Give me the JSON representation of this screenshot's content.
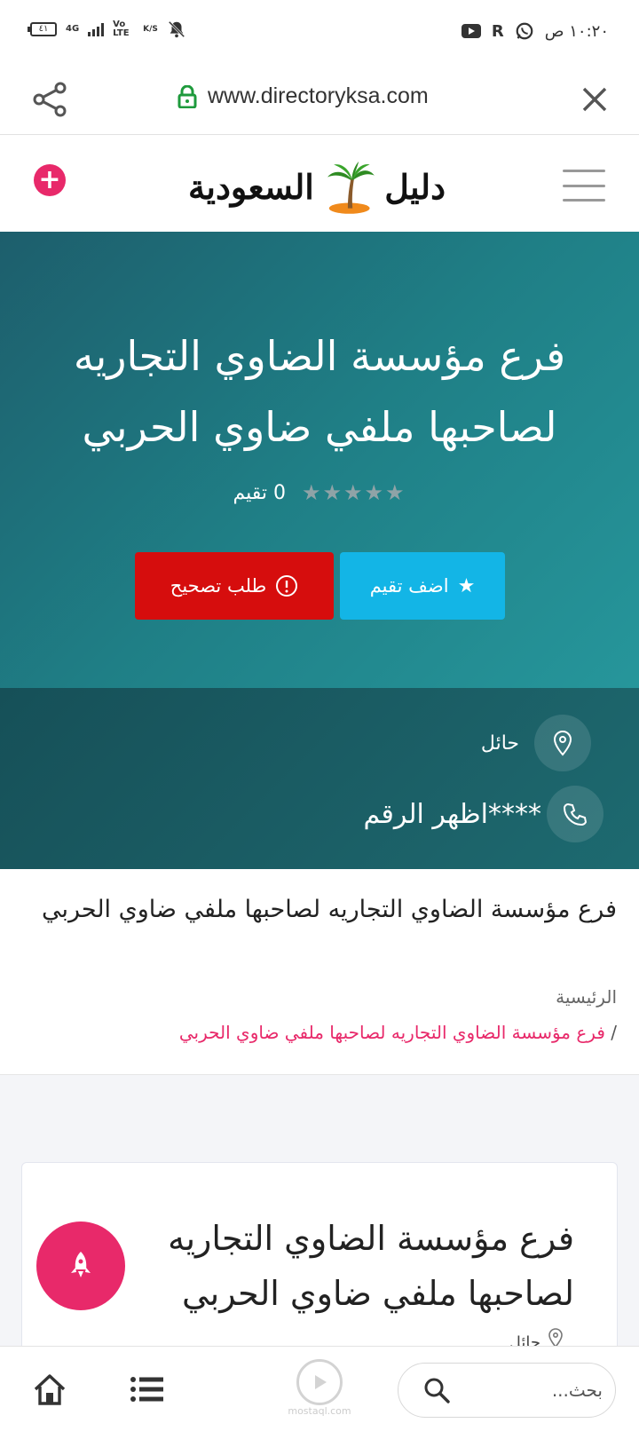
{
  "status_bar": {
    "time": "١٠:٢٠ ص",
    "battery": "٤١",
    "network": "4G",
    "volte": "Vo LTE",
    "speed": "K/S"
  },
  "browser": {
    "url": "www.directoryksa.com"
  },
  "site": {
    "logo_text_right": "دليل",
    "logo_text_left": "السعودية"
  },
  "hero": {
    "title": "فرع مؤسسة الضاوي التجاريه لصاحبها ملفي ضاوي الحربي",
    "rating_text": "0 تقيم",
    "rating_value": 0,
    "rating_max": 5,
    "review_button": "اضف تقيم",
    "fix_button": "طلب تصحيح"
  },
  "info": {
    "city": "حائل",
    "phone": "****اظهر الرقم"
  },
  "breadcrumb": {
    "title": "فرع مؤسسة الضاوي التجاريه لصاحبها ملفي ضاوي الحربي",
    "home": "الرئيسية",
    "separator": "/",
    "current": "فرع مؤسسة الضاوي التجاريه لصاحبها ملفي ضاوي الحربي"
  },
  "card": {
    "title": "فرع مؤسسة الضاوي التجاريه لصاحبها ملفي ضاوي الحربي",
    "city": "حائل"
  },
  "bottom_bar": {
    "search_placeholder": "بحث...",
    "watermark": "mostaql.com"
  },
  "colors": {
    "accent_pink": "#e8296a",
    "review_blue": "#13b5e6",
    "fix_red": "#d60d0d",
    "hero_teal": "#1f7f86"
  },
  "icons": {
    "share": "share-icon",
    "lock": "lock-icon",
    "close": "close-icon",
    "plus": "plus-circle-icon",
    "menu": "hamburger-icon",
    "star": "star-icon",
    "alert": "alert-circle-icon",
    "location": "map-pin-icon",
    "phone": "phone-icon",
    "rocket": "rocket-icon",
    "home": "home-icon",
    "list": "list-icon",
    "search": "search-icon"
  }
}
